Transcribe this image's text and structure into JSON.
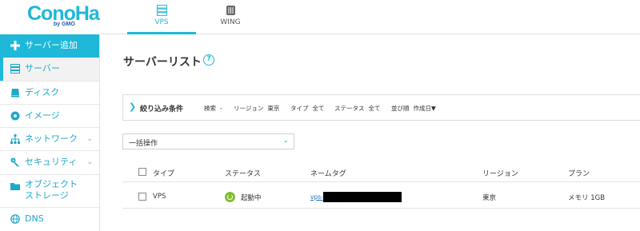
{
  "brand": {
    "logo": "ConoHa",
    "logo_sub": "by GMO"
  },
  "topnav": [
    {
      "label": "VPS",
      "icon": "server-stack-icon",
      "active": true
    },
    {
      "label": "WING",
      "icon": "wing-icon",
      "active": false
    }
  ],
  "sidebar": {
    "items": [
      {
        "label": "サーバー追加",
        "icon": "plus-icon"
      },
      {
        "label": "サーバー",
        "icon": "server-icon"
      },
      {
        "label": "ディスク",
        "icon": "disk-icon"
      },
      {
        "label": "イメージ",
        "icon": "image-icon"
      },
      {
        "label": "ネットワーク",
        "icon": "network-icon",
        "expandable": true
      },
      {
        "label": "セキュリティ",
        "icon": "key-icon",
        "expandable": true
      },
      {
        "label": "オブジェクト\nストレージ",
        "icon": "folder-icon"
      },
      {
        "label": "DNS",
        "icon": "globe-icon"
      }
    ]
  },
  "main": {
    "title": "サーバーリスト",
    "help": "?",
    "filter": {
      "title": "絞り込み条件",
      "fields": [
        {
          "label": "検索",
          "value": "-"
        },
        {
          "label": "リージョン",
          "value": "東京"
        },
        {
          "label": "タイプ",
          "value": "全て"
        },
        {
          "label": "ステータス",
          "value": "全て"
        },
        {
          "label": "並び順",
          "value": "作成日▼"
        }
      ]
    },
    "bulk_action": {
      "label": "一括操作"
    },
    "table": {
      "headers": [
        "タイプ",
        "ステータス",
        "ネームタグ",
        "リージョン",
        "プラン"
      ],
      "rows": [
        {
          "type": "VPS",
          "status": "起動中",
          "nametag": "vps-",
          "region": "東京",
          "plan": "メモリ 1GB"
        }
      ]
    }
  },
  "colors": {
    "accent": "#1fb8d8",
    "status_running": "#7fbf2f",
    "link": "#1f6fbf"
  }
}
